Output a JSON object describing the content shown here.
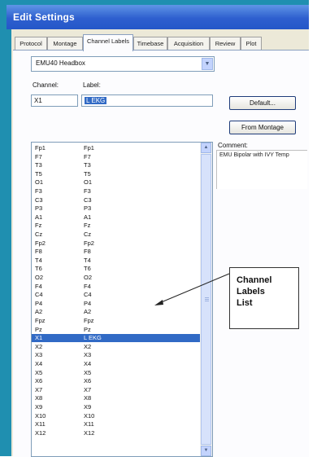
{
  "window": {
    "title": "Edit Settings"
  },
  "tabs": [
    {
      "label": "Protocol",
      "active": false
    },
    {
      "label": "Montage",
      "active": false
    },
    {
      "label": "Channel Labels",
      "active": true
    },
    {
      "label": "Timebase",
      "active": false
    },
    {
      "label": "Acquisition",
      "active": false
    },
    {
      "label": "Review",
      "active": false
    },
    {
      "label": "Plot",
      "active": false
    }
  ],
  "headbox": {
    "selected": "EMU40 Headbox"
  },
  "fields": {
    "channel_label": "Channel:",
    "label_label": "Label:",
    "channel_value": "X1",
    "label_value": "L EKG"
  },
  "buttons": {
    "default": "Default...",
    "from_montage": "From Montage"
  },
  "comment": {
    "label": "Comment:",
    "text": "EMU Bipolar with IVY Temp"
  },
  "channel_list": [
    {
      "channel": "Fp1",
      "label": "Fp1"
    },
    {
      "channel": "F7",
      "label": "F7"
    },
    {
      "channel": "T3",
      "label": "T3"
    },
    {
      "channel": "T5",
      "label": "T5"
    },
    {
      "channel": "O1",
      "label": "O1"
    },
    {
      "channel": "F3",
      "label": "F3"
    },
    {
      "channel": "C3",
      "label": "C3"
    },
    {
      "channel": "P3",
      "label": "P3"
    },
    {
      "channel": "A1",
      "label": "A1"
    },
    {
      "channel": "Fz",
      "label": "Fz"
    },
    {
      "channel": "Cz",
      "label": "Cz"
    },
    {
      "channel": "Fp2",
      "label": "Fp2"
    },
    {
      "channel": "F8",
      "label": "F8"
    },
    {
      "channel": "T4",
      "label": "T4"
    },
    {
      "channel": "T6",
      "label": "T6"
    },
    {
      "channel": "O2",
      "label": "O2"
    },
    {
      "channel": "F4",
      "label": "F4"
    },
    {
      "channel": "C4",
      "label": "C4"
    },
    {
      "channel": "P4",
      "label": "P4"
    },
    {
      "channel": "A2",
      "label": "A2"
    },
    {
      "channel": "Fpz",
      "label": "Fpz"
    },
    {
      "channel": "Pz",
      "label": "Pz"
    },
    {
      "channel": "X1",
      "label": "L EKG",
      "selected": true
    },
    {
      "channel": "X2",
      "label": "X2"
    },
    {
      "channel": "X3",
      "label": "X3"
    },
    {
      "channel": "X4",
      "label": "X4"
    },
    {
      "channel": "X5",
      "label": "X5"
    },
    {
      "channel": "X6",
      "label": "X6"
    },
    {
      "channel": "X7",
      "label": "X7"
    },
    {
      "channel": "X8",
      "label": "X8"
    },
    {
      "channel": "X9",
      "label": "X9"
    },
    {
      "channel": "X10",
      "label": "X10"
    },
    {
      "channel": "X11",
      "label": "X11"
    },
    {
      "channel": "X12",
      "label": "X12"
    }
  ],
  "annotation": {
    "text": "Channel\nLabels\nList"
  },
  "icons": {
    "combo_dropdown": "chevron-down-icon",
    "scroll_up": "arrow-up-icon",
    "scroll_down": "arrow-down-icon"
  }
}
